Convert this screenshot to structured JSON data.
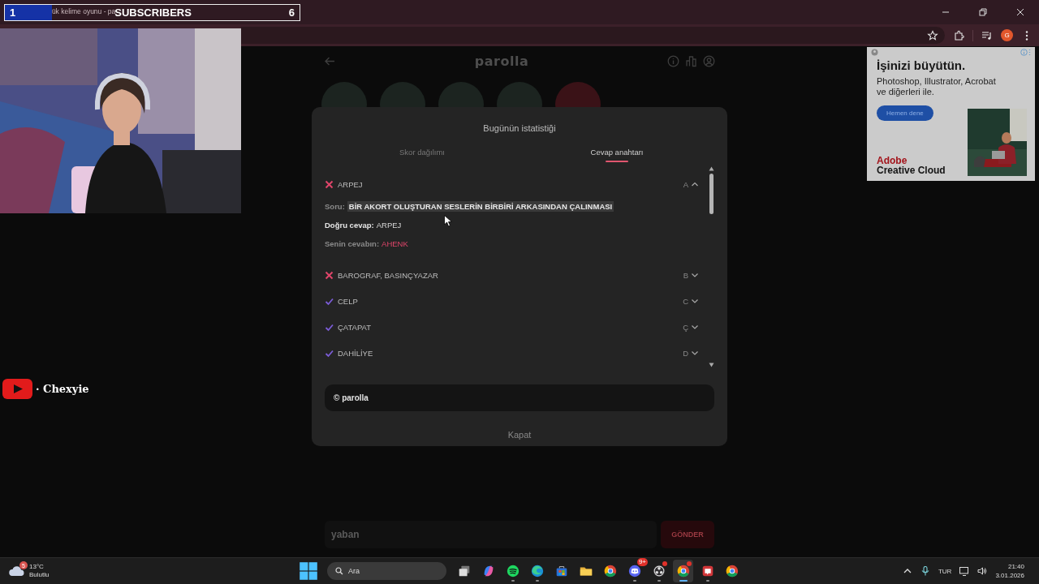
{
  "stream_overlay": {
    "subscribers": {
      "current": "1",
      "label": "SUBSCRIBERS",
      "goal": "6",
      "level": 0.16
    },
    "channel": "· Chexyie"
  },
  "browser": {
    "tab_title": "lük kelime oyunu - pa",
    "profile_initial": "G"
  },
  "page": {
    "logo": "parolla",
    "circles": [
      {
        "color": "#1c2420"
      },
      {
        "color": "#1c2420"
      },
      {
        "color": "#1c2420"
      },
      {
        "color": "#1c2420"
      },
      {
        "color": "#3a1217"
      }
    ],
    "answer_field": {
      "value": "yaban"
    },
    "submit_button": "GÖNDER"
  },
  "modal": {
    "title": "Bugünün istatistiği",
    "tabs": [
      {
        "label": "Skor dağılımı",
        "selected": false
      },
      {
        "label": "Cevap anahtarı",
        "selected": true
      }
    ],
    "answers": [
      {
        "word": "ARPEJ",
        "letter": "A",
        "correct": false,
        "expanded": true,
        "details": {
          "question_label": "Soru:",
          "question": "BİR AKORT OLUŞTURAN SESLERİN BİRBİRİ ARKASINDAN ÇALINMASI",
          "correct_label": "Doğru cevap:",
          "correct_answer": "ARPEJ",
          "your_label": "Senin cevabın:",
          "your_answer": "AHENK"
        }
      },
      {
        "word": "BAROGRAF, BASINÇYAZAR",
        "letter": "B",
        "correct": false,
        "expanded": false
      },
      {
        "word": "CELP",
        "letter": "C",
        "correct": true,
        "expanded": false
      },
      {
        "word": "ÇATAPAT",
        "letter": "Ç",
        "correct": true,
        "expanded": false
      },
      {
        "word": "DAHİLİYE",
        "letter": "D",
        "correct": true,
        "expanded": false
      }
    ],
    "footer": "© parolla",
    "close_button": "Kapat"
  },
  "ad": {
    "headline": "İşinizi büyütün.",
    "body": "Photoshop, Illustrator, Acrobat ve diğerleri ile.",
    "button": "Hemen dene",
    "brand_top": "Adobe",
    "brand_bottom": "Creative Cloud"
  },
  "taskbar": {
    "weather": {
      "badge": "5",
      "temperature": "13°C",
      "condition": "Bulutlu"
    },
    "search_placeholder": "Ara",
    "apps": [
      {
        "kind": "taskview",
        "running": false,
        "active": false,
        "alert": false
      },
      {
        "kind": "copilot",
        "running": false,
        "active": false,
        "alert": false
      },
      {
        "kind": "spotify",
        "running": true,
        "active": false,
        "alert": false
      },
      {
        "kind": "edge",
        "running": true,
        "active": false,
        "alert": false
      },
      {
        "kind": "store",
        "running": false,
        "active": false,
        "alert": false
      },
      {
        "kind": "folder",
        "running": false,
        "active": false,
        "alert": false
      },
      {
        "kind": "chrome",
        "running": false,
        "active": false,
        "alert": false
      },
      {
        "kind": "discord",
        "running": true,
        "active": false,
        "alert": false,
        "badge": "9+"
      },
      {
        "kind": "obs",
        "running": true,
        "active": false,
        "alert": true
      },
      {
        "kind": "chrome",
        "running": true,
        "active": true,
        "alert": true
      },
      {
        "kind": "redapp",
        "running": true,
        "active": false,
        "alert": false
      },
      {
        "kind": "chrome",
        "running": false,
        "active": false,
        "alert": false
      }
    ],
    "language": "TUR",
    "time": "21:40",
    "date": "3.01.2026"
  }
}
